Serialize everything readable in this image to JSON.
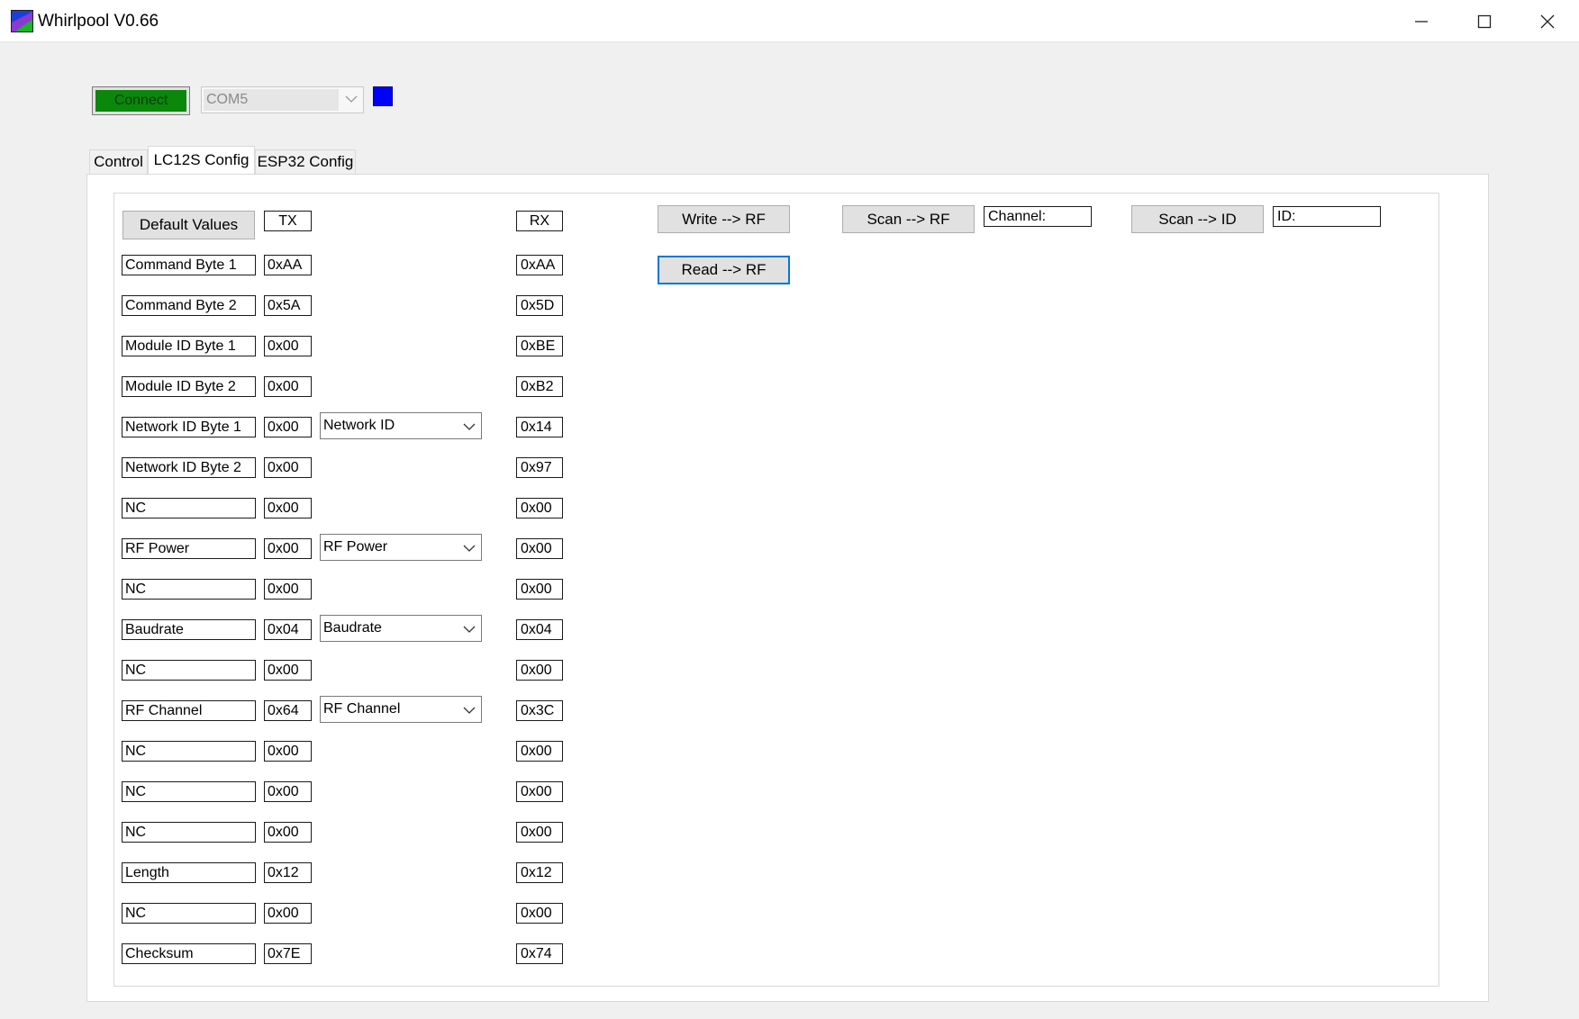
{
  "window": {
    "title": "Whirlpool V0.66"
  },
  "toolbar": {
    "connect_label": "Connect",
    "com_port": "COM5",
    "status_color": "#0000ff"
  },
  "tabs": [
    {
      "label": "Control",
      "active": false
    },
    {
      "label": "LC12S Config",
      "active": true
    },
    {
      "label": "ESP32 Config",
      "active": false
    }
  ],
  "config": {
    "default_button": "Default Values",
    "tx_header": "TX",
    "rx_header": "RX",
    "rows": [
      {
        "label": "Command Byte 1",
        "tx": "0xAA",
        "rx": "0xAA"
      },
      {
        "label": "Command Byte 2",
        "tx": "0x5A",
        "rx": "0x5D"
      },
      {
        "label": "Module ID Byte 1",
        "tx": "0x00",
        "rx": "0xBE"
      },
      {
        "label": "Module ID Byte 2",
        "tx": "0x00",
        "rx": "0xB2"
      },
      {
        "label": "Network ID Byte 1",
        "tx": "0x00",
        "rx": "0x14",
        "dropdown": "Network ID"
      },
      {
        "label": "Network ID Byte 2",
        "tx": "0x00",
        "rx": "0x97"
      },
      {
        "label": "NC",
        "tx": "0x00",
        "rx": "0x00"
      },
      {
        "label": "RF Power",
        "tx": "0x00",
        "rx": "0x00",
        "dropdown": "RF Power"
      },
      {
        "label": "NC",
        "tx": "0x00",
        "rx": "0x00"
      },
      {
        "label": "Baudrate",
        "tx": "0x04",
        "rx": "0x04",
        "dropdown": "Baudrate"
      },
      {
        "label": "NC",
        "tx": "0x00",
        "rx": "0x00"
      },
      {
        "label": "RF Channel",
        "tx": "0x64",
        "rx": "0x3C",
        "dropdown": "RF Channel"
      },
      {
        "label": "NC",
        "tx": "0x00",
        "rx": "0x00"
      },
      {
        "label": "NC",
        "tx": "0x00",
        "rx": "0x00"
      },
      {
        "label": "NC",
        "tx": "0x00",
        "rx": "0x00"
      },
      {
        "label": "Length",
        "tx": "0x12",
        "rx": "0x12"
      },
      {
        "label": "NC",
        "tx": "0x00",
        "rx": "0x00"
      },
      {
        "label": "Checksum",
        "tx": "0x7E",
        "rx": "0x74"
      }
    ]
  },
  "actions": {
    "write_rf": "Write --> RF",
    "read_rf": "Read --> RF",
    "scan_rf": "Scan --> RF",
    "channel_field": "Channel:",
    "scan_id": "Scan --> ID",
    "id_field": "ID:"
  }
}
